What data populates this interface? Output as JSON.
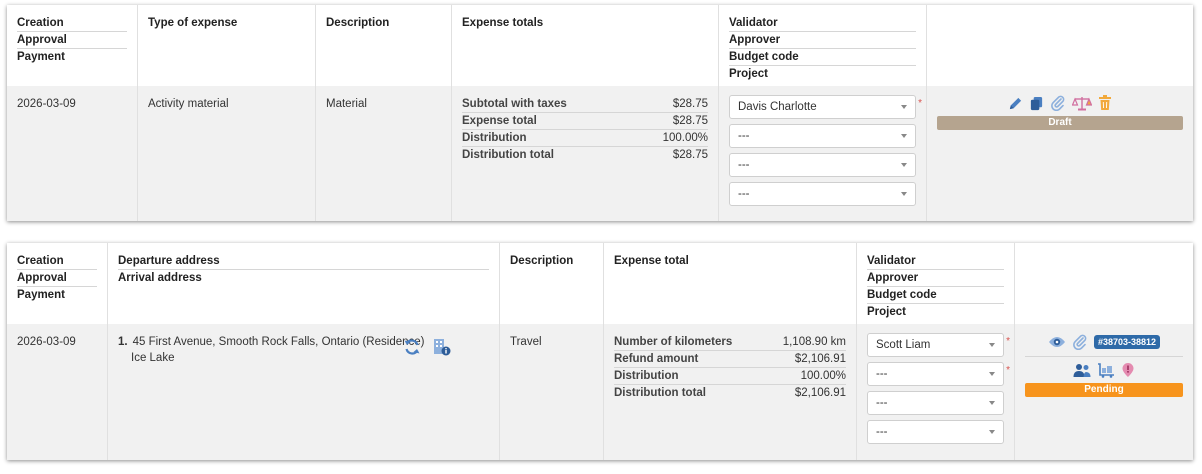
{
  "card1": {
    "header": {
      "col1": [
        "Creation",
        "Approval",
        "Payment"
      ],
      "col2": "Type of expense",
      "col3": "Description",
      "col4": "Expense totals",
      "col5": [
        "Validator",
        "Approver",
        "Budget code",
        "Project"
      ]
    },
    "row": {
      "date": "2026-03-09",
      "type": "Activity material",
      "description": "Material",
      "totals": [
        {
          "label": "Subtotal with taxes",
          "value": "$28.75"
        },
        {
          "label": "Expense total",
          "value": "$28.75"
        },
        {
          "label": "Distribution",
          "value": "100.00%"
        },
        {
          "label": "Distribution total",
          "value": "$28.75"
        }
      ],
      "selects": [
        "Davis Charlotte",
        "---",
        "---",
        "---"
      ],
      "required_mark": "*",
      "icons": [
        "pencil-icon",
        "copy-icon",
        "paperclip-icon",
        "scale-icon",
        "trash-icon"
      ],
      "status": "Draft",
      "status_color": "#b5a48f"
    }
  },
  "card2": {
    "header": {
      "col1": [
        "Creation",
        "Approval",
        "Payment"
      ],
      "col2": [
        "Departure address",
        "Arrival address"
      ],
      "col3": "Description",
      "col4": "Expense total",
      "col5": [
        "Validator",
        "Approver",
        "Budget code",
        "Project"
      ]
    },
    "row": {
      "date": "2026-03-09",
      "address_index": "1.",
      "departure": "45 First Avenue, Smooth Rock Falls, Ontario (Residence)",
      "arrival": "Ice Lake",
      "description": "Travel",
      "totals": [
        {
          "label": "Number of kilometers",
          "value": "1,108.90 km"
        },
        {
          "label": "Refund amount",
          "value": "$2,106.91"
        },
        {
          "label": "Distribution",
          "value": "100.00%"
        },
        {
          "label": "Distribution total",
          "value": "$2,106.91"
        }
      ],
      "selects": [
        "Scott Liam",
        "---",
        "---",
        "---"
      ],
      "required_mark": "*",
      "badge": "#38703-38812",
      "icons": [
        "eye-icon",
        "paperclip-icon",
        "badge",
        "users-icon",
        "cart-icon",
        "alert-pin-icon"
      ],
      "status": "Pending",
      "status_color": "#f7941d"
    }
  },
  "colors": {
    "icon_blue": "#4a7fc1",
    "icon_light_blue": "#8db0dd",
    "icon_orange": "#f2a93b",
    "icon_pink": "#e48bb0"
  }
}
